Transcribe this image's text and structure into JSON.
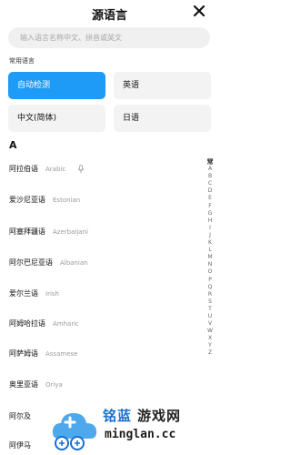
{
  "header": {
    "title": "源语言"
  },
  "search": {
    "placeholder": "输入语言名称中文、拼音或英文"
  },
  "common": {
    "label": "常用语言",
    "chips": [
      {
        "label": "自动检测",
        "active": true
      },
      {
        "label": "英语",
        "active": false
      },
      {
        "label": "中文(简体)",
        "active": false
      },
      {
        "label": "日语",
        "active": false
      }
    ]
  },
  "section_letter": "A",
  "languages": [
    {
      "name": "阿拉伯语",
      "native": "Arabic",
      "mic": true
    },
    {
      "name": "爱沙尼亚语",
      "native": "Estonian"
    },
    {
      "name": "阿塞拜疆语",
      "native": "Azerbaijani"
    },
    {
      "name": "阿尔巴尼亚语",
      "native": "Albanian"
    },
    {
      "name": "爱尔兰语",
      "native": "Irish"
    },
    {
      "name": "阿姆哈拉语",
      "native": "Amharic"
    },
    {
      "name": "阿萨姆语",
      "native": "Assamese"
    },
    {
      "name": "奥里亚语",
      "native": "Oriya"
    },
    {
      "name": "阿尔及",
      "native": ""
    },
    {
      "name": "阿伊马",
      "native": ""
    }
  ],
  "alphabet": [
    "常",
    "A",
    "B",
    "C",
    "D",
    "E",
    "F",
    "G",
    "H",
    "I",
    "J",
    "K",
    "L",
    "M",
    "N",
    "O",
    "P",
    "Q",
    "R",
    "S",
    "T",
    "U",
    "V",
    "W",
    "X",
    "Y",
    "Z"
  ],
  "watermark": {
    "cn_blue": "铭蓝",
    "cn_black": "游戏网",
    "url": "minglan.cc"
  },
  "colors": {
    "accent": "#1e9bf6",
    "chip_bg": "#f3f3f3",
    "search_bg": "#f0f0f0",
    "watermark_blue": "#1a6fd1"
  }
}
